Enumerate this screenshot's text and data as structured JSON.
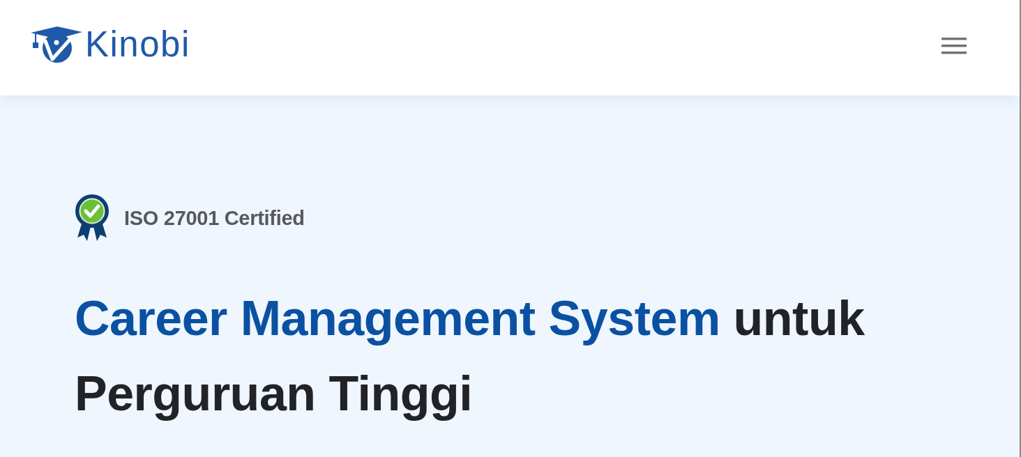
{
  "header": {
    "logo_text": "Kinobi"
  },
  "hero": {
    "badge": {
      "label": "ISO 27001 Certified"
    },
    "heading": {
      "highlight": "Career Management System",
      "rest": "untuk Perguruan Tinggi"
    }
  }
}
